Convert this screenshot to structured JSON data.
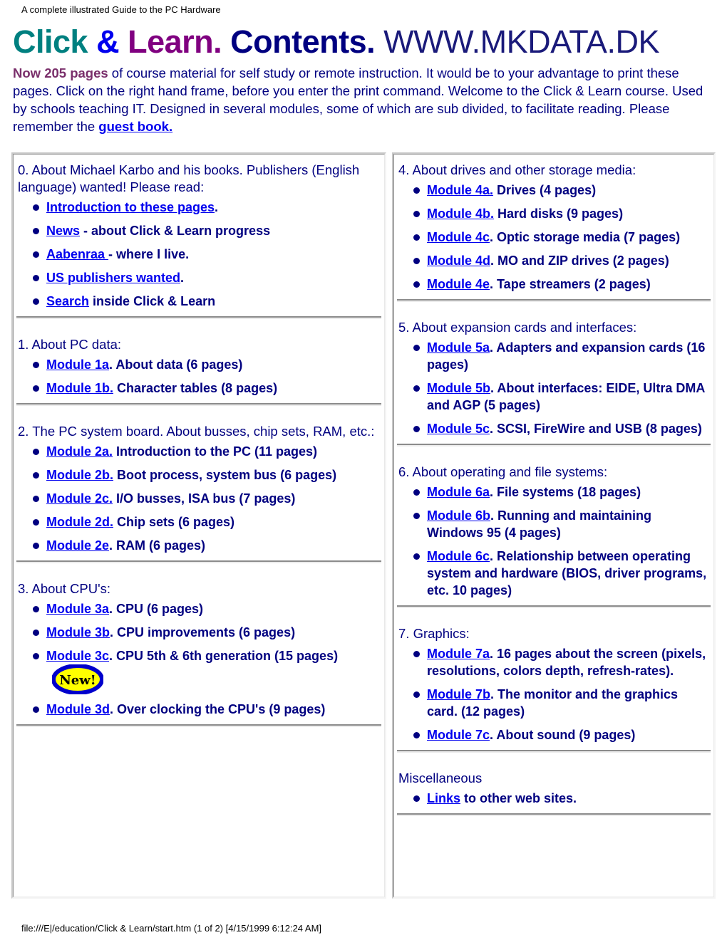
{
  "page_head": "A complete illustrated Guide to the PC Hardware",
  "title": {
    "click": "Click",
    "amp": "&",
    "learn": "Learn.",
    "contents": "Contents.",
    "url": "WWW.MKDATA.DK"
  },
  "intro": {
    "highlight": "Now 205 pages",
    "body": " of course material for self study or remote  instruction. It would be to your advantage to print these pages. Click on the right hand frame, before you enter the print command. Welcome to the Click & Learn course. Used by schools teaching IT.  Designed in several modules, some of which are sub divided, to facilitate reading. Please remember the ",
    "link_label": "guest book.",
    "tail": ""
  },
  "colors": {
    "click": "#008080",
    "amp": "#0000ee",
    "learn": "#800080",
    "contents": "#000080",
    "url": "#1a1a7a",
    "highlight": "#7a2f6b",
    "text": "#000080",
    "link": "#0000ee",
    "badge_fill": "#ffff00",
    "badge_stroke": "#0000cc"
  },
  "left_column": [
    {
      "heading": "0. About Michael Karbo and his books. Publishers (English language) wanted! Please read:",
      "items": [
        {
          "link": "Introduction to these pages",
          "rest": "."
        },
        {
          "link": "News",
          "rest": " - about Click & Learn progress"
        },
        {
          "link": "Aabenraa ",
          "rest": "- where I live."
        },
        {
          "link": "US publishers wanted",
          "rest": "."
        },
        {
          "link": "Search",
          "rest": " inside Click & Learn"
        }
      ]
    },
    {
      "heading": "1. About PC data:",
      "items": [
        {
          "link": "Module 1a",
          "rest": ". About data (6 pages)"
        },
        {
          "link": "Module 1b.",
          "rest": " Character tables (8 pages)"
        }
      ]
    },
    {
      "heading": "2. The PC system board. About busses, chip sets, RAM, etc.:",
      "items": [
        {
          "link": "Module 2a.",
          "rest": " Introduction to the PC (11 pages)"
        },
        {
          "link": "Module 2b.",
          "rest": " Boot process, system bus (6 pages)"
        },
        {
          "link": "Module 2c.",
          "rest": " I/O busses, ISA bus (7 pages)"
        },
        {
          "link": "Module 2d.",
          "rest": " Chip sets (6 pages)"
        },
        {
          "link": "Module 2e",
          "rest": ". RAM (6 pages)"
        }
      ]
    },
    {
      "heading": "3. About CPU's:",
      "items": [
        {
          "link": "Module 3a",
          "rest": ". CPU (6 pages)"
        },
        {
          "link": "Module 3b",
          "rest": ". CPU improvements (6 pages)"
        },
        {
          "link": "Module 3c",
          "rest": ". CPU 5th & 6th generation (15 pages)",
          "badge": "New!"
        },
        {
          "link": "Module 3d",
          "rest": ". Over clocking the CPU's (9 pages)"
        }
      ]
    }
  ],
  "right_column": [
    {
      "heading": "4. About drives and other storage media:",
      "items": [
        {
          "link": "Module 4a.",
          "rest": " Drives (4 pages)"
        },
        {
          "link": "Module 4b.",
          "rest": " Hard disks (9 pages)"
        },
        {
          "link": "Module 4c",
          "rest": ". Optic storage media (7 pages)"
        },
        {
          "link": "Module 4d",
          "rest": ". MO and ZIP drives (2 pages)"
        },
        {
          "link": "Module 4e",
          "rest": ". Tape streamers (2 pages)"
        }
      ]
    },
    {
      "heading": "5. About expansion cards and interfaces:",
      "items": [
        {
          "link": "Module 5a",
          "rest": ".  Adapters and expansion cards (16 pages)"
        },
        {
          "link": "Module 5b",
          "rest": ".  About interfaces: EIDE, Ultra DMA and AGP (5 pages)"
        },
        {
          "link": "Module 5c",
          "rest": ".  SCSI, FireWire and USB (8 pages)"
        }
      ]
    },
    {
      "heading": "6. About operating and file systems:",
      "items": [
        {
          "link": "Module 6a",
          "rest": ". File systems (18 pages)"
        },
        {
          "link": "Module 6b",
          "rest": ". Running and maintaining Windows 95 (4 pages)"
        },
        {
          "link": "Module 6c",
          "rest": ". Relationship between operating system and hardware (BIOS, driver programs, etc. 10 pages)"
        }
      ]
    },
    {
      "heading": "7. Graphics:",
      "items": [
        {
          "link": "Module 7a",
          "rest": ". 16 pages about the screen (pixels, resolutions, colors depth, refresh-rates)."
        },
        {
          "link": "Module 7b",
          "rest": ". The monitor and the graphics card. (12 pages)"
        },
        {
          "link": "Module 7c",
          "rest": ". About sound (9 pages)"
        }
      ]
    },
    {
      "heading": "Miscellaneous",
      "items": [
        {
          "link": "Links",
          "rest": " to other web sites."
        }
      ]
    }
  ],
  "footer": "file:///E|/education/Click & Learn/start.htm (1 of 2) [4/15/1999 6:12:24 AM]"
}
